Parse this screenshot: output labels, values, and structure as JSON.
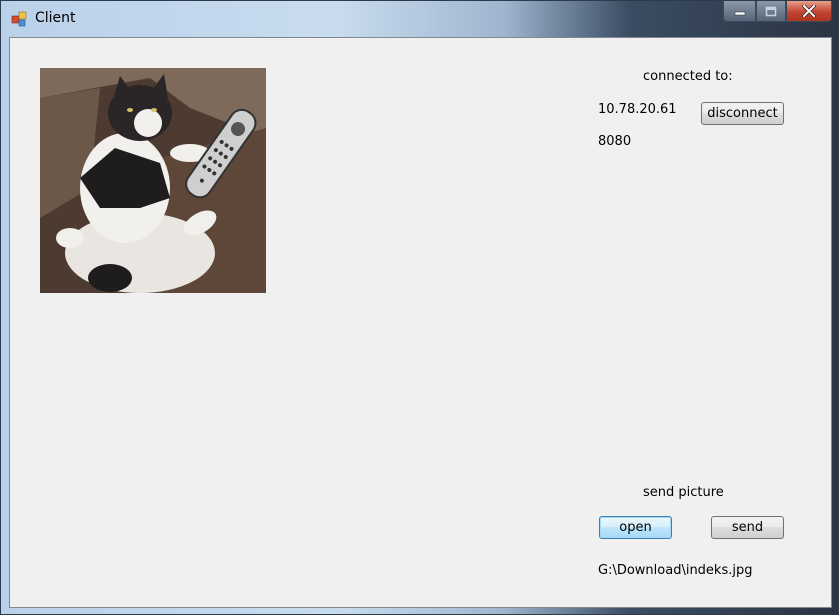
{
  "window": {
    "title": "Client",
    "controls": {
      "minimize": "minimize",
      "maximize": "maximize",
      "close": "close"
    }
  },
  "connection": {
    "header": "connected to:",
    "ip": "10.78.20.61",
    "port": "8080",
    "disconnect_label": "disconnect"
  },
  "send": {
    "header": "send picture",
    "open_label": "open",
    "send_label": "send",
    "file_path": "G:\\Download\\indeks.jpg"
  },
  "colors": {
    "client_bg": "#f0f0f0",
    "close_red": "#c24532",
    "title_bar": "#b9d1ea"
  }
}
